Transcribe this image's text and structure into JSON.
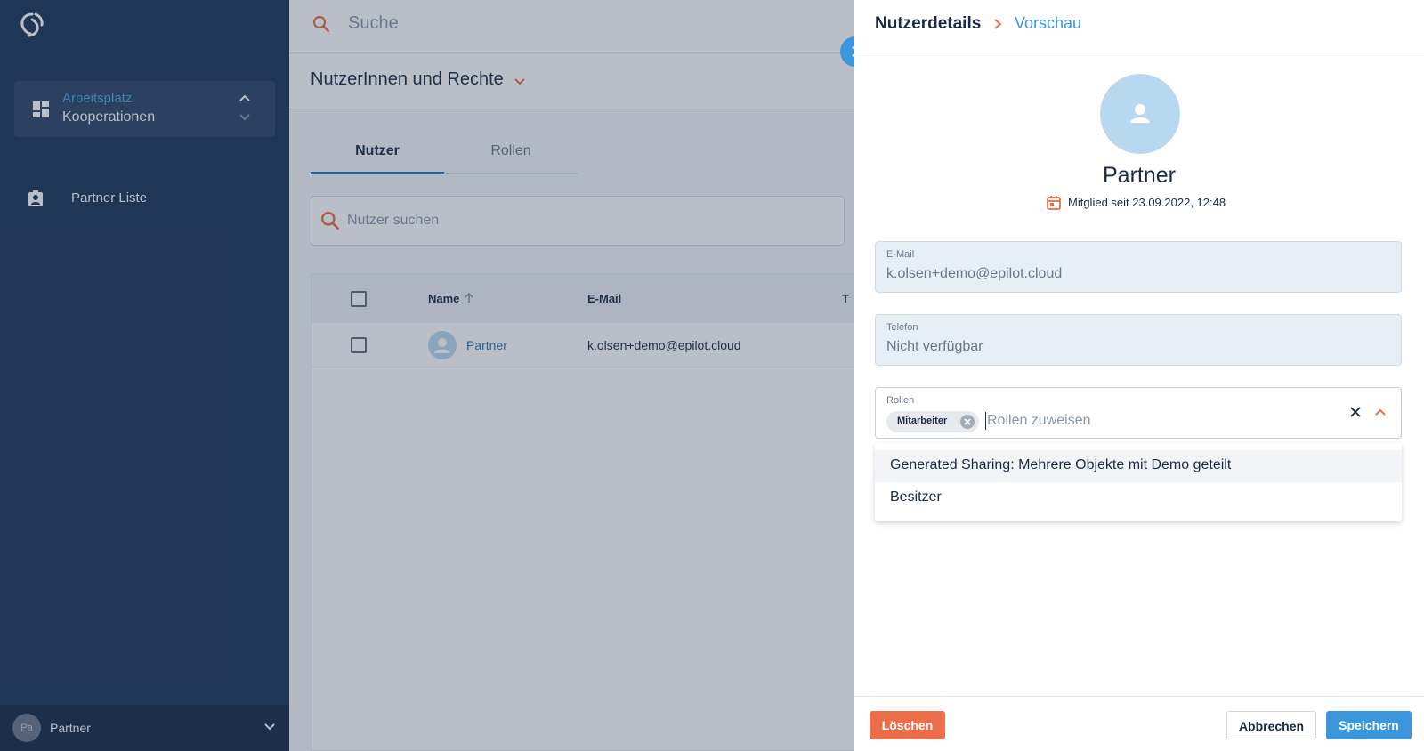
{
  "colors": {
    "sidebar_bg": "#1d3557",
    "accent_blue": "#3b96dc",
    "accent_orange": "#ec6d4a",
    "text_dark": "#1c2b45"
  },
  "sidebar": {
    "logo_icon": "epilot-logo-icon",
    "workspace": {
      "title": "Arbeitsplatz",
      "subtitle": "Kooperationen",
      "icon": "dashboard-icon"
    },
    "nav_items": [
      {
        "label": "Partner Liste",
        "icon": "clipboard-user-icon"
      }
    ],
    "user": {
      "initials": "Pa",
      "name": "Partner"
    }
  },
  "topbar": {
    "search_placeholder": "Suche"
  },
  "header": {
    "title": "NutzerInnen und Rechte"
  },
  "tabs": [
    {
      "label": "Nutzer",
      "active": true
    },
    {
      "label": "Rollen",
      "active": false
    }
  ],
  "user_search": {
    "placeholder": "Nutzer suchen"
  },
  "table": {
    "columns": [
      "Name",
      "E-Mail",
      "T"
    ],
    "rows": [
      {
        "name": "Partner",
        "email": "k.olsen+demo@epilot.cloud"
      }
    ]
  },
  "panel": {
    "breadcrumb": {
      "current": "Nutzerdetails",
      "link": "Vorschau"
    },
    "profile_name": "Partner",
    "member_since": "Mitglied seit 23.09.2022, 12:48",
    "email": {
      "label": "E-Mail",
      "value": "k.olsen+demo@epilot.cloud"
    },
    "phone": {
      "label": "Telefon",
      "value": "Nicht verfügbar"
    },
    "roles": {
      "label": "Rollen",
      "selected_chip": "Mitarbeiter",
      "placeholder": "Rollen zuweisen",
      "options": [
        "Generated Sharing: Mehrere Objekte mit Demo geteilt",
        "Besitzer"
      ]
    },
    "buttons": {
      "delete": "Löschen",
      "cancel": "Abbrechen",
      "save": "Speichern"
    }
  }
}
